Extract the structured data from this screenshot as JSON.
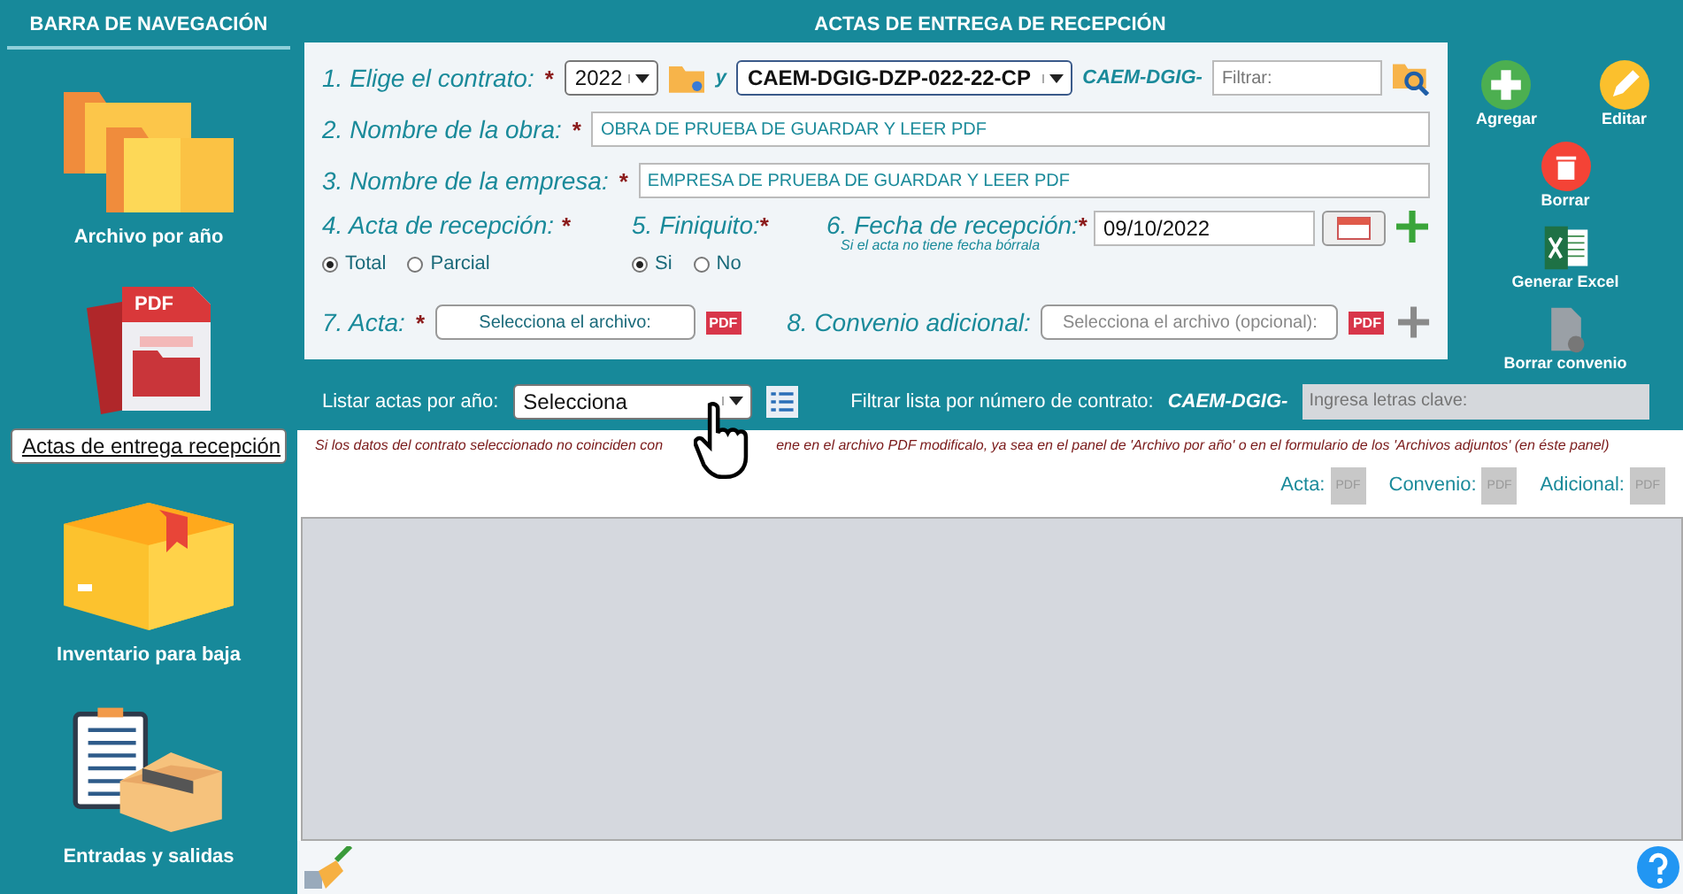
{
  "sidebar": {
    "title": "BARRA DE NAVEGACIÓN",
    "items": [
      {
        "label": "Archivo por año",
        "selected": false
      },
      {
        "label": "Actas de entrega recepción",
        "selected": true,
        "badge": "PDF"
      },
      {
        "label": "Inventario para baja",
        "selected": false
      },
      {
        "label": "Entradas y salidas",
        "selected": false
      }
    ]
  },
  "header": {
    "title": "ACTAS DE ENTREGA DE RECEPCIÓN"
  },
  "form": {
    "contract": {
      "label": "1. Elige el contrato:",
      "required_mark": "*",
      "year": "2022",
      "connector": "y",
      "value": "CAEM-DGIG-DZP-022-22-CP",
      "prefix": "CAEM-DGIG-",
      "placeholder": "Filtrar:"
    },
    "work_name": {
      "label": "2. Nombre de la obra:",
      "required_mark": "*",
      "value": "OBRA DE PRUEBA DE GUARDAR Y LEER PDF"
    },
    "company": {
      "label": "3. Nombre de la empresa:",
      "required_mark": "*",
      "value": "EMPRESA DE PRUEBA DE GUARDAR Y LEER PDF"
    },
    "acta_type": {
      "label": "4. Acta de recepción:",
      "required_mark": "*",
      "options": [
        {
          "label": "Total",
          "selected": true
        },
        {
          "label": "Parcial",
          "selected": false
        }
      ]
    },
    "finiquito": {
      "label": "5. Finiquito:",
      "required_mark": "*",
      "options": [
        {
          "label": "Si",
          "selected": true
        },
        {
          "label": "No",
          "selected": false
        }
      ]
    },
    "date": {
      "label": "6. Fecha de recepción:",
      "required_mark": "*",
      "hint": "Si el acta no tiene fecha bórrala",
      "value": "09/10/2022"
    },
    "acta_file": {
      "label": "7. Acta:",
      "required_mark": "*",
      "button": "Selecciona el archivo:",
      "icon_label": "PDF",
      "disabled": false
    },
    "convenio": {
      "label": "8. Convenio adicional:",
      "button": "Selecciona el archivo (opcional):",
      "icon_label": "PDF",
      "disabled": true
    }
  },
  "actions": [
    {
      "label": "Agregar"
    },
    {
      "label": "Editar"
    },
    {
      "label": "Borrar"
    },
    {
      "label": "Generar Excel"
    },
    {
      "label": "Borrar convenio"
    }
  ],
  "filter_bar": {
    "year_label": "Listar actas por año:",
    "year_value": "Selecciona",
    "contract_label": "Filtrar lista por número de contrato:",
    "prefix": "CAEM-DGIG-",
    "placeholder": "Ingresa letras clave:"
  },
  "notice": [
    "Si los datos del contrato seleccionado no coinciden con",
    "ene en el archivo PDF modificalo, ya sea en el panel de 'Archivo por año' o en el formulario de los 'Archivos adjuntos' (en éste panel)"
  ],
  "attachments": [
    {
      "label": "Acta:",
      "icon_label": "PDF"
    },
    {
      "label": "Convenio:",
      "icon_label": "PDF"
    },
    {
      "label": "Adicional:",
      "icon_label": "PDF"
    }
  ]
}
